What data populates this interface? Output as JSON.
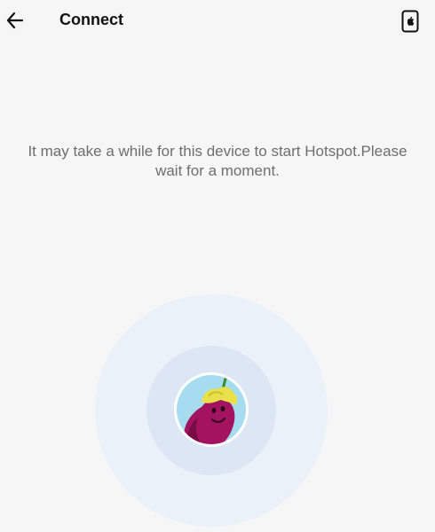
{
  "header": {
    "title": "Connect",
    "back_icon": "arrow-left-icon",
    "device_icon": "phone-apple-icon"
  },
  "main": {
    "message_line1": "It may take a while for this device to start Hotspot.Please",
    "message_line2": "wait for a moment."
  },
  "avatar": {
    "icon": "eggplant-avatar-icon"
  },
  "colors": {
    "background": "#f6f6f6",
    "message_text": "#6e6e6e",
    "ring_outer": "#eaf1f9",
    "ring_mid": "#dce6f4",
    "avatar_bg": "#a6dcef",
    "eggplant": "#a4135f",
    "leaf": "#e9e14a"
  }
}
